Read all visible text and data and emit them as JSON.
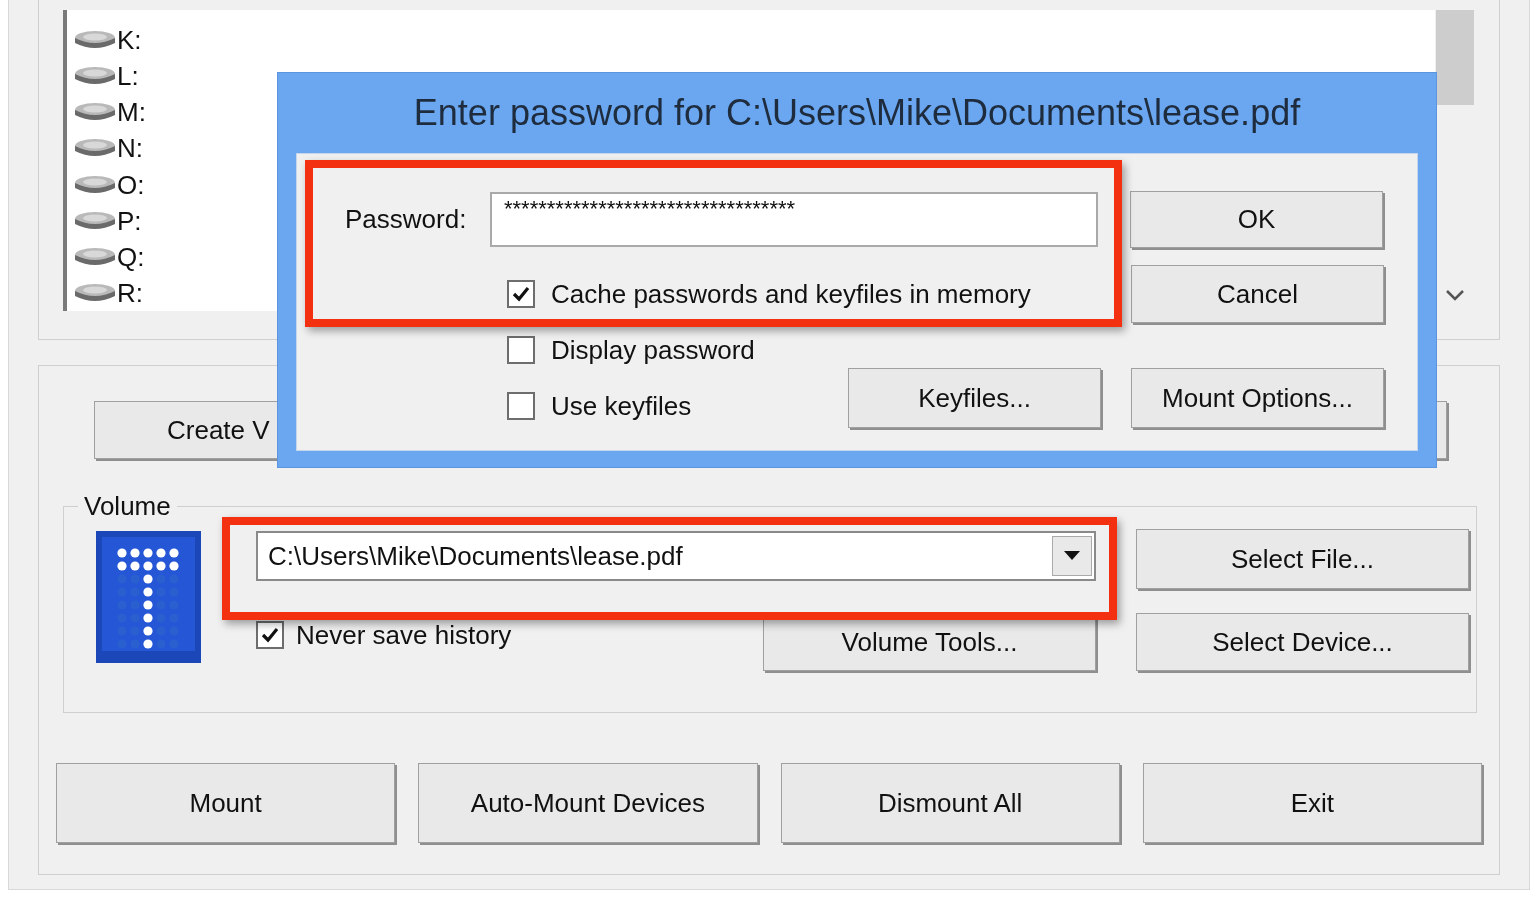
{
  "drives": [
    "K:",
    "L:",
    "M:",
    "N:",
    "O:",
    "P:",
    "Q:",
    "R:"
  ],
  "top_buttons": [
    "Create V"
  ],
  "volume": {
    "legend": "Volume",
    "path": "C:\\Users\\Mike\\Documents\\lease.pdf",
    "never_save_history": {
      "label": "Never save history",
      "checked": true
    },
    "select_file": "Select File...",
    "volume_tools": "Volume Tools...",
    "select_device": "Select Device..."
  },
  "bottom_buttons": [
    "Mount",
    "Auto-Mount Devices",
    "Dismount All",
    "Exit"
  ],
  "dialog": {
    "title": "Enter password for C:\\Users\\Mike\\Documents\\lease.pdf",
    "password_label": "Password:",
    "password_value": "**********************************",
    "checkboxes": [
      {
        "label": "Cache passwords and keyfiles in memory",
        "checked": true
      },
      {
        "label": "Display password",
        "checked": false
      },
      {
        "label": "Use keyfiles",
        "checked": false
      }
    ],
    "ok": "OK",
    "cancel": "Cancel",
    "keyfiles": "Keyfiles...",
    "mount_options": "Mount Options..."
  }
}
